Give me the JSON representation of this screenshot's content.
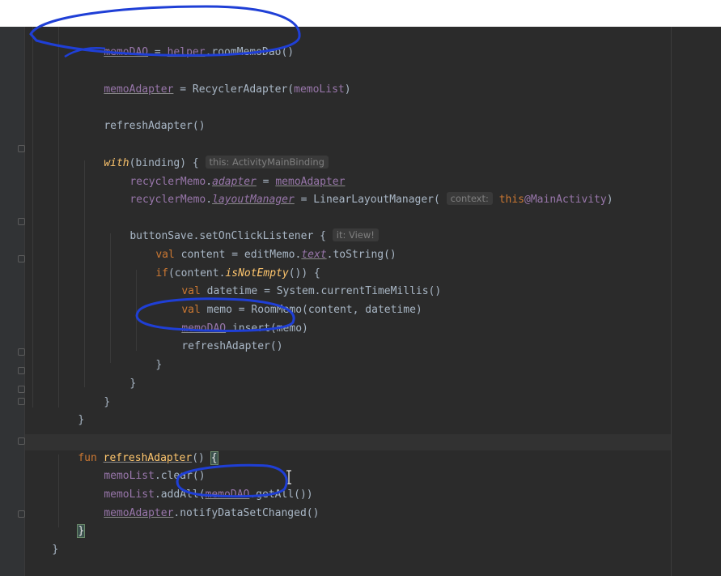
{
  "code": {
    "l1": {
      "memoDAO": "memoDAO",
      "eq": " = ",
      "helper": "helper",
      "rest": ".roomMemoDao()"
    },
    "l2": {
      "memoAdapter": "memoAdapter",
      "eq": " = RecyclerAdapter(",
      "memoList": "memoList",
      "close": ")"
    },
    "l3": {
      "text": "refreshAdapter()"
    },
    "l4": {
      "with": "with",
      "open": "(binding) { ",
      "hint": "this: ActivityMainBinding"
    },
    "l5": {
      "recyclerMemo": "recyclerMemo",
      "dot": ".",
      "adapter": "adapter",
      "eq": " = ",
      "memoAdapter": "memoAdapter"
    },
    "l6": {
      "recyclerMemo": "recyclerMemo",
      "dot": ".",
      "layoutManager": "layoutManager",
      "eq": " = LinearLayoutManager( ",
      "hint": "context:",
      "sp": " ",
      "thisKw": "this",
      "label": "@MainActivity",
      "close": ")"
    },
    "l7": {
      "text": "buttonSave.setOnClickListener { ",
      "hint": "it: View!"
    },
    "l8": {
      "val": "val",
      "mid": " content = editMemo.",
      "text": "text",
      "rest": ".toString()"
    },
    "l9": {
      "iff": "if",
      "mid": "(content.",
      "isNotEmpty": "isNotEmpty",
      "rest": "()) {"
    },
    "l10": {
      "val": "val",
      "rest": " datetime = System.currentTimeMillis()"
    },
    "l11": {
      "val": "val",
      "rest": " memo = RoomMemo(content, datetime)"
    },
    "l12": {
      "memoDAO": "memoDAO",
      "rest": ".insert(memo)"
    },
    "l13": {
      "text": "refreshAdapter()"
    },
    "l14": {
      "text": "}"
    },
    "l15": {
      "text": "}"
    },
    "l16": {
      "text": "}"
    },
    "l17": {
      "text": "}"
    },
    "l18": {
      "fun": "fun",
      "sp": " ",
      "name": "refreshAdapter",
      "paren": "() ",
      "brace": "{"
    },
    "l19": {
      "memoList": "memoList",
      "rest": ".clear()"
    },
    "l20": {
      "memoList": "memoList",
      "mid": ".addAll(",
      "memoDAO": "memoDAO",
      "rest": ".getAll())"
    },
    "l21": {
      "memoAdapter": "memoAdapter",
      "rest": ".notifyDataSetChanged()"
    },
    "l22": {
      "text": "}"
    },
    "l23": {
      "text": "}"
    }
  },
  "colors": {
    "background": "#2b2b2b",
    "keyword": "#cc7832",
    "property": "#9876aa",
    "function": "#ffc66d",
    "plain": "#a9b7c6",
    "annotation_ink": "#1f3fd6"
  },
  "icons": {
    "fold": "fold-marker-icon",
    "cursor": "text-cursor-icon"
  }
}
